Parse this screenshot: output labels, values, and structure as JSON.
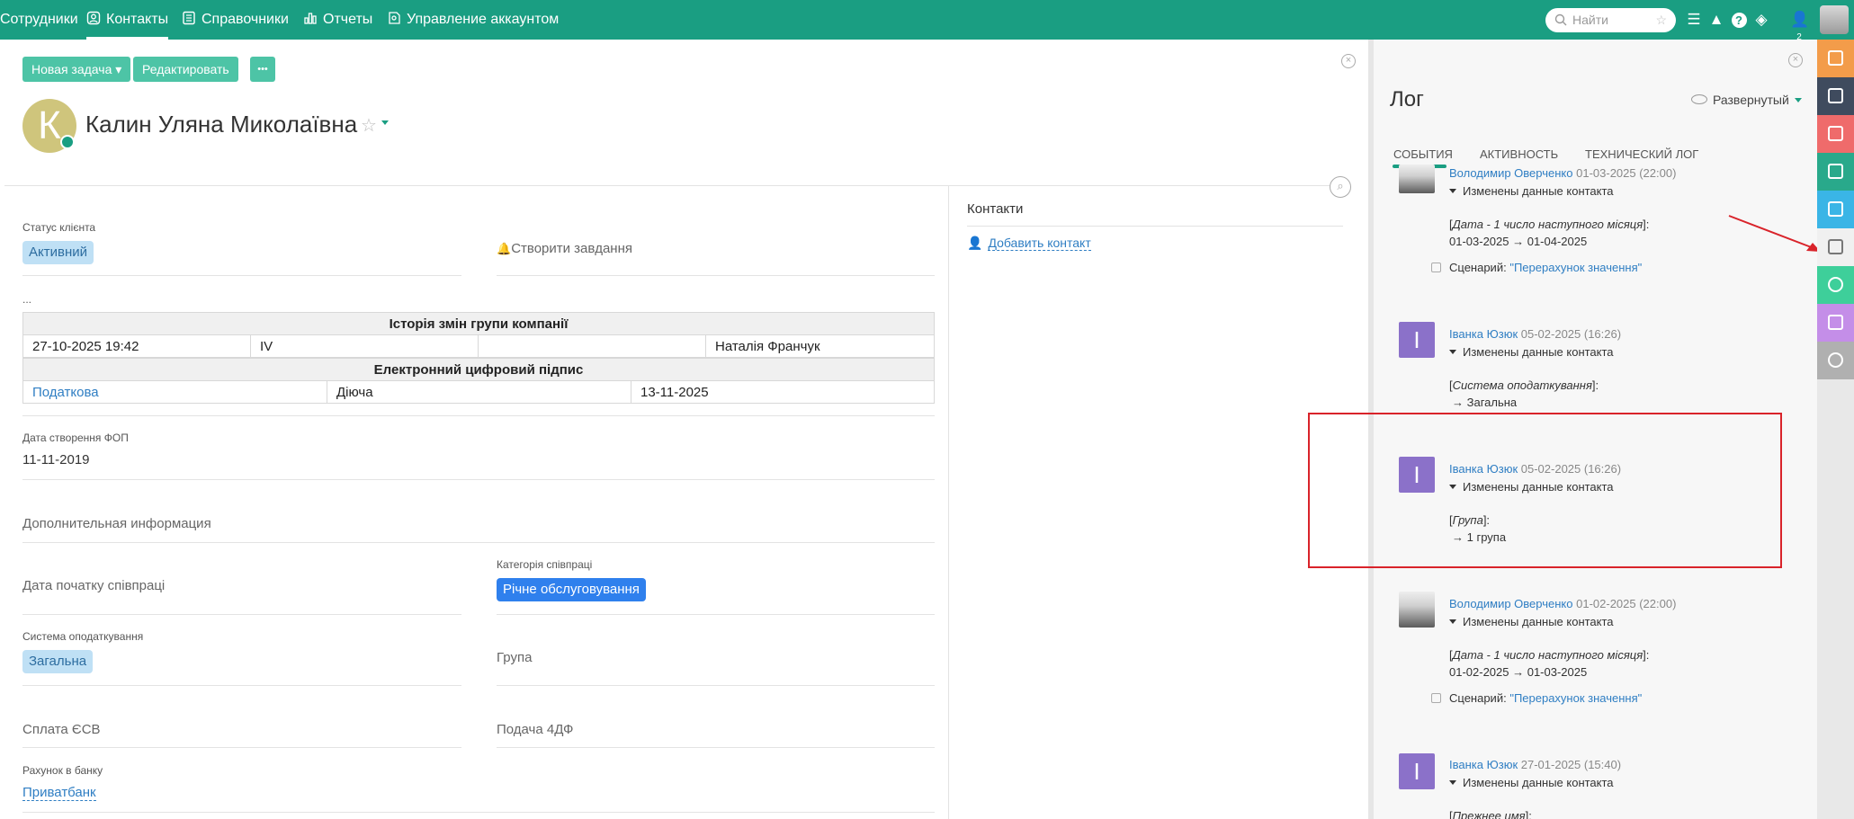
{
  "nav": {
    "items": [
      {
        "label": "Сотрудники",
        "icon": "people-icon"
      },
      {
        "label": "Контакты",
        "icon": "contact-card-icon",
        "active": true
      },
      {
        "label": "Справочники",
        "icon": "book-icon"
      },
      {
        "label": "Отчеты",
        "icon": "bar-chart-icon"
      },
      {
        "label": "Управление аккаунтом",
        "icon": "account-settings-icon"
      }
    ],
    "search_placeholder": "Найти",
    "notifications_count": "2"
  },
  "toolbar": {
    "new_task_label": "Новая задача",
    "edit_label": "Редактировать",
    "more_label": "•••"
  },
  "person": {
    "initial": "К",
    "name": "Калин Уляна Миколаївна"
  },
  "fields": {
    "client_status_label": "Статус клієнта",
    "client_status_value": "Активний",
    "create_task_label": "Створити завдання",
    "dots": "...",
    "group_history_title": "Історія змін групи компанії",
    "group_history_row": [
      "27-10-2025 19:42",
      "IV",
      "",
      "Наталія Франчук"
    ],
    "edsign_title": "Електронний цифровий підпис",
    "edsign_row": [
      "Податкова",
      "Діюча",
      "13-11-2025"
    ],
    "fop_date_label": "Дата створення ФОП",
    "fop_date_value": "11-11-2019",
    "extra_info_label": "Дополнительная информация",
    "coop_start_label": "Дата початку співпраці",
    "coop_category_label": "Категорія співпраці",
    "coop_category_value": "Річне обслуговування",
    "tax_system_label": "Система оподаткування",
    "tax_system_value": "Загальна",
    "group_label": "Група",
    "esv_label": "Сплата ЄСВ",
    "form4df_label": "Подача 4ДФ",
    "bank_label": "Рахунок в банку",
    "bank_value": "Приватбанк"
  },
  "contacts": {
    "title": "Контакти",
    "add_label": "Добавить контакт"
  },
  "log": {
    "title": "Лог",
    "view_mode": "Развернутый",
    "tabs": [
      "События",
      "Активность",
      "Технический лог"
    ],
    "entries": [
      {
        "author": "Володимир Оверченко",
        "date": "01-03-2025 (22:00)",
        "change": "Изменены данные контакта",
        "field": "Дата - 1 число наступного місяця",
        "value": "01-03-2025 → 01-04-2025",
        "scenario_label": "Сценарий:",
        "scenario": "\"Перерахунок значення\""
      },
      {
        "author": "Іванка Юзюк",
        "initial": "І",
        "date": "05-02-2025 (16:26)",
        "change": "Изменены данные контакта",
        "field": "Система оподаткування",
        "value": "→ Загальна"
      },
      {
        "author": "Іванка Юзюк",
        "initial": "І",
        "date": "05-02-2025 (16:26)",
        "change": "Изменены данные контакта",
        "field": "Група",
        "value": "→ 1 група"
      },
      {
        "author": "Володимир Оверченко",
        "date": "01-02-2025 (22:00)",
        "change": "Изменены данные контакта",
        "field": "Дата - 1 число наступного місяця",
        "value": "01-02-2025 → 01-03-2025",
        "scenario_label": "Сценарий:",
        "scenario": "\"Перерахунок значення\""
      },
      {
        "author": "Іванка Юзюк",
        "initial": "І",
        "date": "27-01-2025 (15:40)",
        "change": "Изменены данные контакта",
        "field": "Прежнее имя"
      }
    ]
  },
  "right_bar": [
    {
      "icon": "chat-icon",
      "color": "#f39c4a"
    },
    {
      "icon": "signpost-icon",
      "color": "#3f4b5e"
    },
    {
      "icon": "task-check-icon",
      "color": "#ef6b6b"
    },
    {
      "icon": "inbox-icon",
      "color": "#29a98b"
    },
    {
      "icon": "documents-icon",
      "color": "#3ab5e6"
    },
    {
      "icon": "clipboard-icon",
      "color": "#f0f0f0",
      "active": true
    },
    {
      "icon": "key-icon",
      "color": "#3ecf9a"
    },
    {
      "icon": "analytics-icon",
      "color": "#c48ee8"
    },
    {
      "icon": "minus-circle-icon",
      "color": "#b0b0b0"
    }
  ]
}
